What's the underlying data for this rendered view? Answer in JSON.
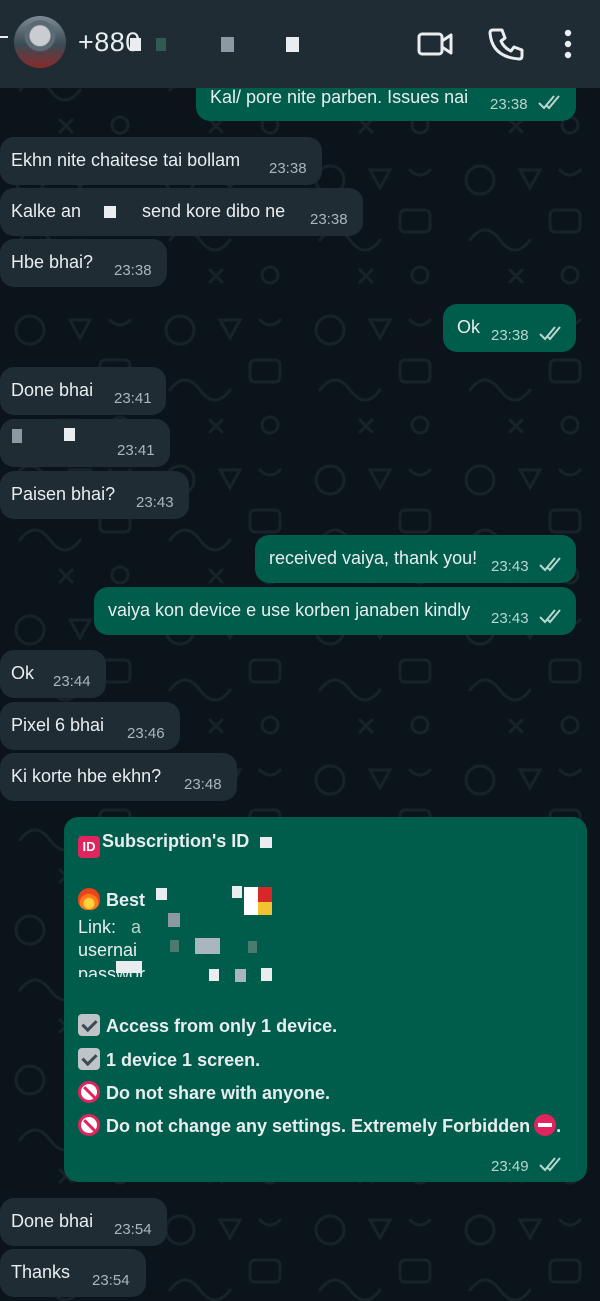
{
  "header": {
    "contact_name": "+880",
    "icons": [
      "back-arrow-icon",
      "video-call-icon",
      "voice-call-icon",
      "more-options-icon"
    ]
  },
  "messages": [
    {
      "dir": "out",
      "text": "Kal/ pore nite parben. Issues nai",
      "time": "23:38",
      "read": true
    },
    {
      "dir": "in",
      "text": "Ekhn nite chaitese tai bollam",
      "time": "23:38"
    },
    {
      "dir": "in",
      "text": "Kalke an",
      "text_b": "send kore dibo ne",
      "time": "23:38"
    },
    {
      "dir": "in",
      "text": "Hbe bhai?",
      "time": "23:38"
    },
    {
      "dir": "out",
      "text": "Ok",
      "time": "23:38",
      "read": true
    },
    {
      "dir": "in",
      "text": "Done bhai",
      "time": "23:41"
    },
    {
      "dir": "in",
      "text": "",
      "time": "23:41"
    },
    {
      "dir": "in",
      "text": "Paisen bhai?",
      "time": "23:43"
    },
    {
      "dir": "out",
      "text": "received vaiya, thank you!",
      "time": "23:43",
      "read": true
    },
    {
      "dir": "out",
      "text": "vaiya kon device e use korben janaben kindly",
      "time": "23:43",
      "read": true
    },
    {
      "dir": "in",
      "text": "Ok",
      "time": "23:44"
    },
    {
      "dir": "in",
      "text": "Pixel 6 bhai",
      "time": "23:46"
    },
    {
      "dir": "in",
      "text": "Ki korte hbe ekhn?",
      "time": "23:48"
    },
    {
      "dir": "in",
      "text": "Done bhai",
      "time": "23:54"
    },
    {
      "dir": "in",
      "text": "Thanks",
      "time": "23:54"
    }
  ],
  "subscription_card": {
    "badge": "ID",
    "title": "Subscription's ID",
    "best_label": "Best",
    "link_label": "Link:",
    "link_value": "a",
    "username_label": "usernai",
    "password_label": "passwor",
    "rules": [
      {
        "icon": "check-box-icon",
        "text": "Access from only 1 device."
      },
      {
        "icon": "check-box-icon",
        "text": "1 device 1 screen."
      },
      {
        "icon": "no-entry-icon",
        "text": "Do not share with anyone."
      },
      {
        "icon": "no-entry-icon",
        "text": "Do not change any settings. Extremely Forbidden",
        "suffix": "."
      }
    ],
    "time": "23:49",
    "read": true
  },
  "colors": {
    "background": "#0b141a",
    "header": "#1f2c34",
    "incoming_bubble": "#1f2c34",
    "outgoing_bubble": "#005c4b",
    "read_ticks": "#b8d6cf"
  }
}
